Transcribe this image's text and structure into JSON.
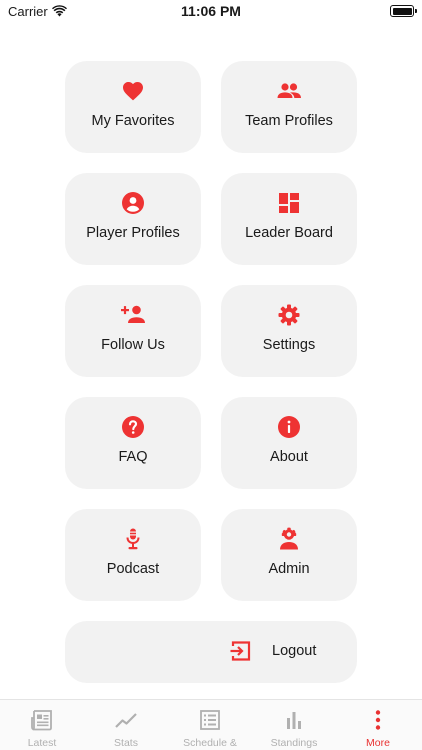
{
  "status_bar": {
    "carrier": "Carrier",
    "time": "11:06 PM",
    "battery_level": 1.0
  },
  "menu": {
    "accent_color": "#ee3333",
    "tiles": [
      {
        "label": "My Favorites",
        "icon": "heart-icon"
      },
      {
        "label": "Team Profiles",
        "icon": "group-icon"
      },
      {
        "label": "Player Profiles",
        "icon": "account-circle-icon"
      },
      {
        "label": "Leader Board",
        "icon": "dashboard-icon"
      },
      {
        "label": "Follow Us",
        "icon": "person-add-icon"
      },
      {
        "label": "Settings",
        "icon": "gear-icon"
      },
      {
        "label": "FAQ",
        "icon": "help-icon"
      },
      {
        "label": "About",
        "icon": "info-icon"
      },
      {
        "label": "Podcast",
        "icon": "microphone-icon"
      },
      {
        "label": "Admin",
        "icon": "admin-icon"
      }
    ],
    "logout": {
      "label": "Logout",
      "icon": "logout-icon"
    }
  },
  "tab_bar": {
    "active_index": 4,
    "tabs": [
      {
        "label": "Latest",
        "icon": "newspaper-icon"
      },
      {
        "label": "Stats",
        "icon": "trend-line-icon"
      },
      {
        "label": "Schedule & Scores",
        "icon": "list-icon"
      },
      {
        "label": "Standings",
        "icon": "bar-chart-icon"
      },
      {
        "label": "More",
        "icon": "more-vertical-icon"
      }
    ]
  }
}
